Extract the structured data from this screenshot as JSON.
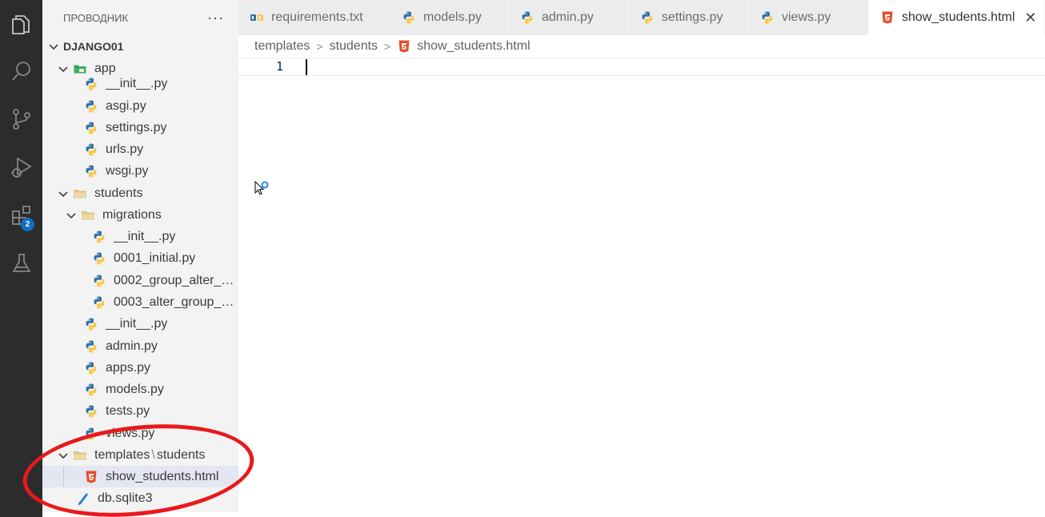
{
  "activity_bar": {
    "icons": [
      "explorer-icon",
      "search-icon",
      "source-control-icon",
      "run-debug-icon",
      "extensions-icon",
      "testing-icon"
    ],
    "extensions_badge": "2"
  },
  "explorer": {
    "title": "ПРОВОДНИК",
    "more": "···",
    "root": "DJANGO01",
    "tree": {
      "app": "app",
      "app_init": "__init__.py",
      "asgi": "asgi.py",
      "settings": "settings.py",
      "urls": "urls.py",
      "wsgi": "wsgi.py",
      "students": "students",
      "migrations": "migrations",
      "mig_init": "__init__.py",
      "mig_0001": "0001_initial.py",
      "mig_0002": "0002_group_alter_st...",
      "mig_0003": "0003_alter_group_o...",
      "st_init": "__init__.py",
      "admin": "admin.py",
      "apps": "apps.py",
      "models": "models.py",
      "tests": "tests.py",
      "views": "views.py",
      "templates_a": "templates",
      "templates_sep": "\\",
      "templates_b": "students",
      "show_students": "show_students.html",
      "db": "db.sqlite3"
    }
  },
  "tabs": [
    {
      "label": "requirements.txt",
      "icon": "pip-icon"
    },
    {
      "label": "models.py",
      "icon": "python-icon"
    },
    {
      "label": "admin.py",
      "icon": "python-icon"
    },
    {
      "label": "settings.py",
      "icon": "python-icon"
    },
    {
      "label": "views.py",
      "icon": "python-icon"
    },
    {
      "label": "show_students.html",
      "icon": "html-icon",
      "active": true,
      "close": "✕"
    }
  ],
  "breadcrumb": [
    "templates",
    "students",
    "show_students.html"
  ],
  "editor": {
    "line_number": "1"
  },
  "colors": {
    "python_blue": "#3572a5",
    "python_yellow": "#f7c948",
    "html_orange": "#e44d26",
    "annotation_red": "#e8191c"
  }
}
